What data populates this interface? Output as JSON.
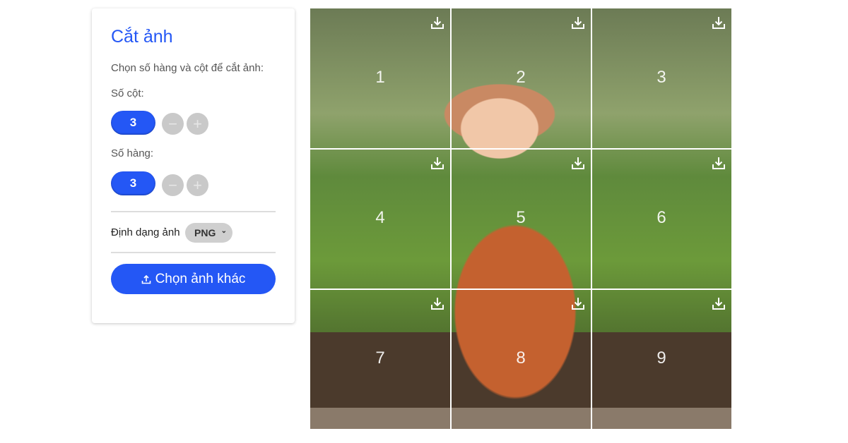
{
  "panel": {
    "title": "Cắt ảnh",
    "description": "Chọn số hàng và cột để cắt ảnh:",
    "columns_label": "Số cột:",
    "columns_value": "3",
    "rows_label": "Số hàng:",
    "rows_value": "3",
    "minus": "−",
    "plus": "+",
    "format_label": "Định dạng ảnh",
    "format_value": "PNG",
    "upload_label": "Chọn ảnh khác",
    "upload_icon": "upload-icon"
  },
  "grid": {
    "cells": [
      "1",
      "2",
      "3",
      "4",
      "5",
      "6",
      "7",
      "8",
      "9"
    ],
    "cell_icon": "download-icon"
  },
  "colors": {
    "accent": "#2457f5"
  }
}
